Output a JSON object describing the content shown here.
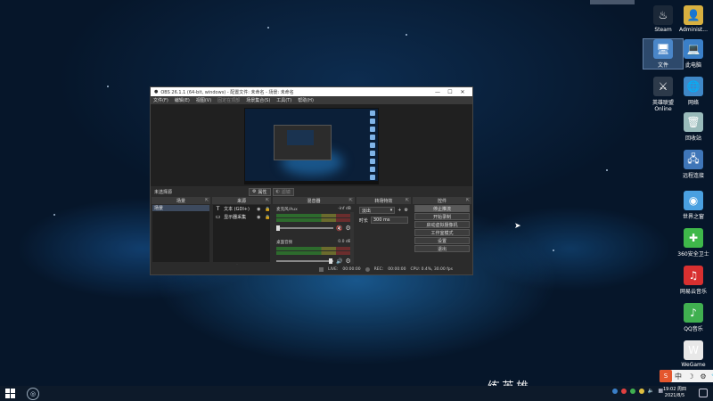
{
  "desktop_icons": [
    {
      "label": "Steam",
      "glyph": "♨",
      "color": "#1b2838",
      "selected": false
    },
    {
      "label": "Administ...",
      "glyph": "👤",
      "color": "#d8b040",
      "selected": false
    },
    {
      "label": "文件",
      "glyph": "🖥",
      "color": "#4a86c8",
      "selected": true
    },
    {
      "label": "此电脑",
      "glyph": "💻",
      "color": "#3a7fc8",
      "selected": false
    },
    {
      "label": "英雄联盟 Online",
      "glyph": "⚔",
      "color": "#2d3a4a",
      "selected": false
    },
    {
      "label": "网络",
      "glyph": "🌐",
      "color": "#3f88c8",
      "selected": false
    },
    {
      "label": "回收站",
      "glyph": "🗑",
      "color": "#9bb",
      "selected": false
    },
    {
      "label": "远程连接",
      "glyph": "🖧",
      "color": "#3f76b8",
      "selected": false
    },
    {
      "label": "世界之窗",
      "glyph": "◉",
      "color": "#4aa0e0",
      "selected": false
    },
    {
      "label": "360安全卫士",
      "glyph": "✚",
      "color": "#3fb84a",
      "selected": false
    },
    {
      "label": "网易云音乐",
      "glyph": "♫",
      "color": "#d83030",
      "selected": false
    },
    {
      "label": "QQ音乐",
      "glyph": "♪",
      "color": "#40b050",
      "selected": false
    },
    {
      "label": "WeGame",
      "glyph": "W",
      "color": "#e8e8e8",
      "selected": false
    }
  ],
  "obs": {
    "title": "OBS 26.1.1 (64-bit, windows) - 配置文件: 未命名 - 场景: 未命名",
    "window_buttons": [
      "—",
      "☐",
      "✕"
    ],
    "menu": [
      {
        "label": "文件(F)",
        "dim": false
      },
      {
        "label": "编辑(E)",
        "dim": false
      },
      {
        "label": "视图(V)",
        "dim": false
      },
      {
        "label": "固定在顶部",
        "dim": true
      },
      {
        "label": "场景集合(S)",
        "dim": false
      },
      {
        "label": "工具(T)",
        "dim": false
      },
      {
        "label": "帮助(H)",
        "dim": false
      }
    ],
    "scene_bar": {
      "no_source": "未选择源",
      "properties": "属性",
      "filters": "滤镜"
    },
    "docks": {
      "scenes": {
        "title": "场景",
        "items": [
          "场景"
        ],
        "footer": [
          "+",
          "−",
          "▲",
          "▼"
        ]
      },
      "sources": {
        "title": "来源",
        "items": [
          {
            "icon": "T",
            "name": "文本 (GDI+)"
          },
          {
            "icon": "▭",
            "name": "显示器采集"
          }
        ],
        "footer": [
          "+",
          "−",
          "⚙",
          "▲",
          "▼"
        ]
      },
      "mixer": {
        "title": "混音器",
        "channels": [
          {
            "name": "麦克风/Aux",
            "db": "-inf dB",
            "muted": true
          },
          {
            "name": "桌面音频",
            "db": "0.0 dB",
            "muted": false
          }
        ]
      },
      "transitions": {
        "title": "转场特效",
        "select": "淡出",
        "duration_label": "时长",
        "duration": "300 ms"
      },
      "controls": {
        "title": "控件",
        "buttons": [
          "停止推流",
          "开始录制",
          "启动虚拟摄像机",
          "工作室模式",
          "设置",
          "退出"
        ]
      }
    },
    "status": {
      "live_label": "LIVE:",
      "live_time": "00:00:00",
      "rec_label": "REC:",
      "rec_time": "00:00:00",
      "cpu": "CPU: 0.4%, 30.00 fps"
    }
  },
  "taskbar": {
    "clock_time": "19:02 周四",
    "clock_date": "2021/8/5",
    "ime": [
      "S",
      "中",
      "☽",
      "⚙",
      "👕"
    ]
  },
  "watermark": "练英雄"
}
